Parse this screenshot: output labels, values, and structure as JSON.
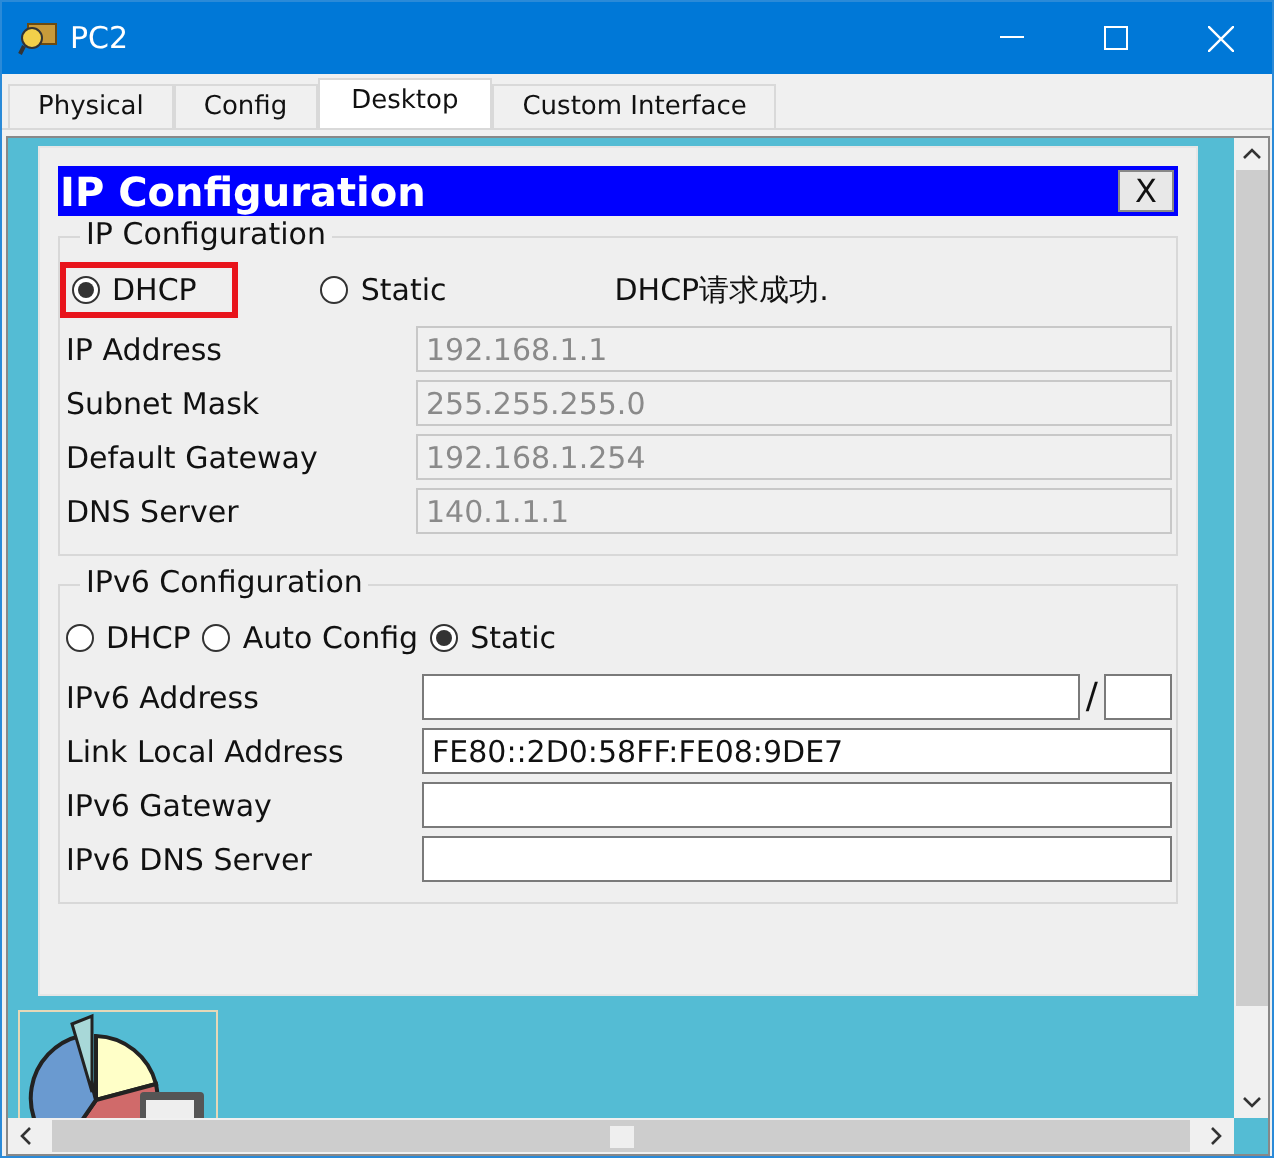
{
  "window": {
    "title": "PC2"
  },
  "tabs": [
    {
      "label": "Physical",
      "selected": false
    },
    {
      "label": "Config",
      "selected": false
    },
    {
      "label": "Desktop",
      "selected": true
    },
    {
      "label": "Custom Interface",
      "selected": false
    }
  ],
  "dialog": {
    "title": "IP Configuration",
    "close_label": "X",
    "ipv4": {
      "legend": "IP Configuration",
      "status": "DHCP请求成功.",
      "modes": [
        {
          "label": "DHCP",
          "selected": true,
          "highlighted": true
        },
        {
          "label": "Static",
          "selected": false,
          "highlighted": false
        }
      ],
      "fields": [
        {
          "label": "IP Address",
          "value": "192.168.1.1",
          "disabled": true
        },
        {
          "label": "Subnet Mask",
          "value": "255.255.255.0",
          "disabled": true
        },
        {
          "label": "Default Gateway",
          "value": "192.168.1.254",
          "disabled": true
        },
        {
          "label": "DNS Server",
          "value": "140.1.1.1",
          "disabled": true
        }
      ]
    },
    "ipv6": {
      "legend": "IPv6 Configuration",
      "modes": [
        {
          "label": "DHCP",
          "selected": false,
          "highlighted": false
        },
        {
          "label": "Auto Config",
          "selected": false,
          "highlighted": false
        },
        {
          "label": "Static",
          "selected": true,
          "highlighted": false
        }
      ],
      "fields": [
        {
          "label": "IPv6 Address",
          "kind": "prefixed",
          "separator": "/",
          "disabled": false
        },
        {
          "label": "Link Local Address",
          "value": "FE80::2D0:58FF:FE08:9DE7",
          "kind": "plain",
          "disabled": false
        },
        {
          "label": "IPv6 Gateway",
          "kind": "plain",
          "disabled": false
        },
        {
          "label": "IPv6 DNS Server",
          "kind": "plain",
          "disabled": false
        }
      ]
    }
  }
}
